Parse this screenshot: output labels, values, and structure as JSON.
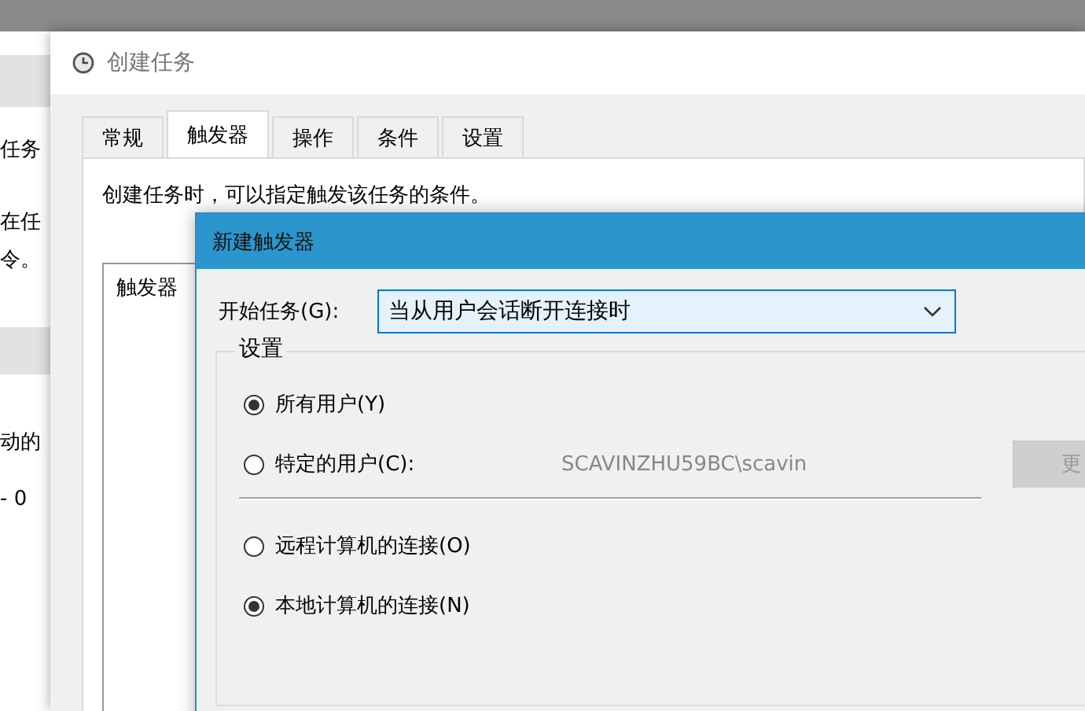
{
  "background_window": {
    "texts": [
      "任务",
      "在任",
      "令。",
      "动的",
      "- 0"
    ]
  },
  "main_window": {
    "title": "创建任务",
    "tabs": [
      {
        "label": "常规",
        "selected": false
      },
      {
        "label": "触发器",
        "selected": true
      },
      {
        "label": "操作",
        "selected": false
      },
      {
        "label": "条件",
        "selected": false
      },
      {
        "label": "设置",
        "selected": false
      }
    ],
    "description": "创建任务时，可以指定触发该任务的条件。",
    "trigger_list": {
      "columns": [
        "触发器"
      ]
    }
  },
  "dialog": {
    "title": "新建触发器",
    "begin_task": {
      "label": "开始任务(G):",
      "value": "当从用户会话断开连接时"
    },
    "settings": {
      "title": "设置",
      "users": [
        {
          "label": "所有用户(Y)",
          "selected": true
        },
        {
          "label": "特定的用户(C):",
          "selected": false,
          "user": "SCAVINZHU59BC\\scavin",
          "button": {
            "label": "更",
            "disabled": true
          }
        }
      ],
      "connections": [
        {
          "label": "远程计算机的连接(O)",
          "selected": false
        },
        {
          "label": "本地计算机的连接(N)",
          "selected": true
        }
      ]
    }
  }
}
